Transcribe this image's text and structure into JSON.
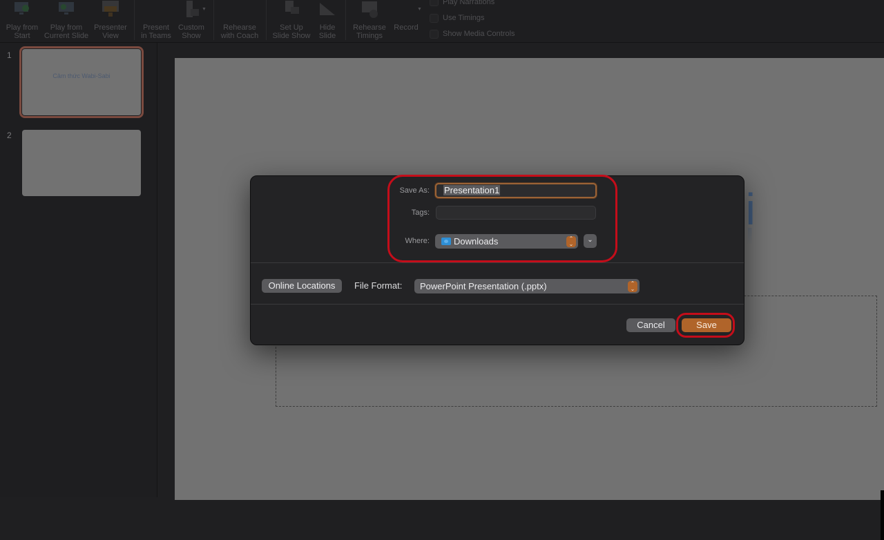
{
  "ribbon": {
    "buttons": [
      {
        "label": "Play from\nStart",
        "icon": "play-from-start-icon"
      },
      {
        "label": "Play from\nCurrent Slide",
        "icon": "play-from-current-icon"
      },
      {
        "label": "Presenter\nView",
        "icon": "presenter-view-icon"
      },
      {
        "label": "Present\nin Teams",
        "icon": "teams-icon"
      },
      {
        "label": "Custom\nShow",
        "icon": "custom-show-icon"
      },
      {
        "label": "Rehearse\nwith Coach",
        "icon": "coach-icon"
      },
      {
        "label": "Set Up\nSlide Show",
        "icon": "setup-slideshow-icon"
      },
      {
        "label": "Hide\nSlide",
        "icon": "hide-slide-icon"
      },
      {
        "label": "Rehearse\nTimings",
        "icon": "rehearse-timings-icon"
      },
      {
        "label": "Record",
        "icon": "record-icon"
      }
    ],
    "checkboxes": [
      {
        "label": "Play Narrations",
        "checked": false
      },
      {
        "label": "Use Timings",
        "checked": false
      },
      {
        "label": "Show Media Controls",
        "checked": false
      }
    ]
  },
  "slides": [
    {
      "number": "1",
      "title": "Cảm thức Wabi-Sabi",
      "selected": true
    },
    {
      "number": "2",
      "title": "",
      "selected": false
    }
  ],
  "slide_canvas": {
    "visible_title_fragment": "bi"
  },
  "dialog": {
    "save_as_label": "Save As:",
    "save_as_value": "Presentation1",
    "tags_label": "Tags:",
    "tags_value": "",
    "where_label": "Where:",
    "where_value": "Downloads",
    "online_locations_label": "Online Locations",
    "file_format_label": "File Format:",
    "file_format_value": "PowerPoint Presentation (.pptx)",
    "cancel_label": "Cancel",
    "save_label": "Save"
  },
  "colors": {
    "accent": "#b0642a",
    "highlight_ring": "#c40d1a",
    "dialog_bg": "#232325"
  }
}
